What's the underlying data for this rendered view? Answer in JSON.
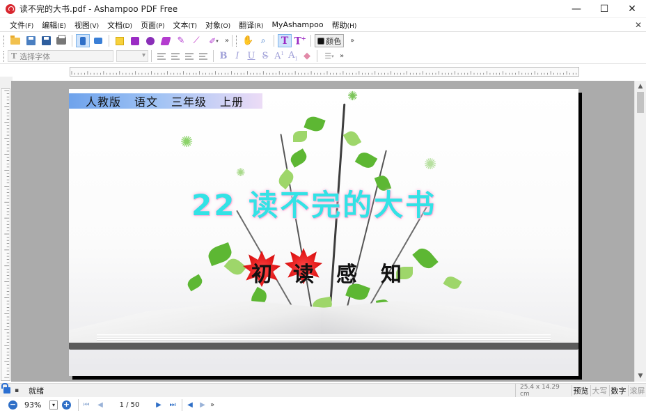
{
  "window": {
    "title": "读不完的大书.pdf - Ashampoo PDF Free",
    "minimize": "—",
    "maximize": "☐",
    "close": "✕"
  },
  "menu": {
    "items": [
      {
        "label": "文件",
        "key": "(F)"
      },
      {
        "label": "编辑",
        "key": "(E)"
      },
      {
        "label": "视图",
        "key": "(V)"
      },
      {
        "label": "文档",
        "key": "(D)"
      },
      {
        "label": "页面",
        "key": "(P)"
      },
      {
        "label": "文本",
        "key": "(T)"
      },
      {
        "label": "对象",
        "key": "(O)"
      },
      {
        "label": "翻译",
        "key": "(R)"
      },
      {
        "label": "MyAshampoo",
        "key": ""
      },
      {
        "label": "帮助",
        "key": "(H)"
      }
    ],
    "close_glyph": "✕"
  },
  "toolbar": {
    "color_label": "颜色",
    "more": "»",
    "font_placeholder": "选择字体"
  },
  "document": {
    "banner": [
      "人教版",
      "语文",
      "三年级",
      "上册"
    ],
    "lesson_title": "22 读不完的大书",
    "subtitle_chars": [
      "初",
      "读",
      "感",
      "知"
    ]
  },
  "status": {
    "text": "就绪",
    "dimensions": "25.4 x 14.29 cm",
    "keys": [
      {
        "label": "预览",
        "on": true
      },
      {
        "label": "大写",
        "on": false
      },
      {
        "label": "数字",
        "on": true
      },
      {
        "label": "滚屏",
        "on": false
      }
    ]
  },
  "navigation": {
    "zoom": "93%",
    "page_indicator": "1 / 50",
    "more": "»"
  },
  "colors": {
    "title_cyan": "#33e2e5",
    "accent_blue": "#2f6fc7",
    "maple_red": "#e01414"
  }
}
